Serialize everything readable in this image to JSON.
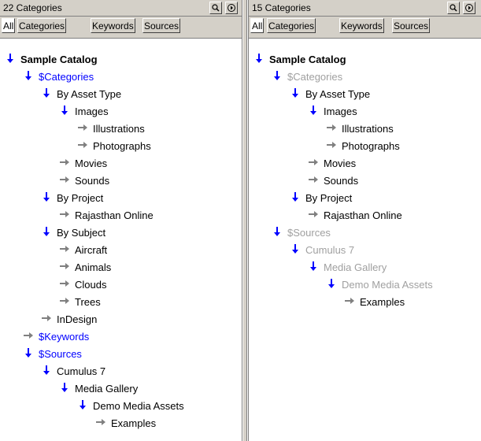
{
  "colors": {
    "link": "#0000ff",
    "dimmed": "#a0a0a0",
    "arrow_expanded": "#0000ff",
    "arrow_collapsed": "#808080"
  },
  "left": {
    "title": "22 Categories",
    "tabs": [
      "All",
      "Categories",
      "Keywords",
      "Sources"
    ],
    "tree": [
      {
        "label": "Sample Catalog",
        "level": 0,
        "arrow": "down",
        "style": "bold"
      },
      {
        "label": "$Categories",
        "level": 1,
        "arrow": "down",
        "style": "blue"
      },
      {
        "label": "By Asset Type",
        "level": 2,
        "arrow": "down",
        "style": "normal"
      },
      {
        "label": "Images",
        "level": 3,
        "arrow": "down",
        "style": "normal"
      },
      {
        "label": "Illustrations",
        "level": 4,
        "arrow": "right",
        "style": "normal"
      },
      {
        "label": "Photographs",
        "level": 4,
        "arrow": "right",
        "style": "normal"
      },
      {
        "label": "Movies",
        "level": 3,
        "arrow": "right",
        "style": "normal"
      },
      {
        "label": "Sounds",
        "level": 3,
        "arrow": "right",
        "style": "normal"
      },
      {
        "label": "By Project",
        "level": 2,
        "arrow": "down",
        "style": "normal"
      },
      {
        "label": "Rajasthan Online",
        "level": 3,
        "arrow": "right",
        "style": "normal"
      },
      {
        "label": "By Subject",
        "level": 2,
        "arrow": "down",
        "style": "normal"
      },
      {
        "label": "Aircraft",
        "level": 3,
        "arrow": "right",
        "style": "normal"
      },
      {
        "label": "Animals",
        "level": 3,
        "arrow": "right",
        "style": "normal"
      },
      {
        "label": "Clouds",
        "level": 3,
        "arrow": "right",
        "style": "normal"
      },
      {
        "label": "Trees",
        "level": 3,
        "arrow": "right",
        "style": "normal"
      },
      {
        "label": "InDesign",
        "level": 2,
        "arrow": "right",
        "style": "normal"
      },
      {
        "label": "$Keywords",
        "level": 1,
        "arrow": "right",
        "style": "blue"
      },
      {
        "label": "$Sources",
        "level": 1,
        "arrow": "down",
        "style": "blue"
      },
      {
        "label": "Cumulus 7",
        "level": 2,
        "arrow": "down",
        "style": "normal"
      },
      {
        "label": "Media Gallery",
        "level": 3,
        "arrow": "down",
        "style": "normal"
      },
      {
        "label": "Demo Media Assets",
        "level": 4,
        "arrow": "down",
        "style": "normal"
      },
      {
        "label": "Examples",
        "level": 5,
        "arrow": "right",
        "style": "normal"
      }
    ]
  },
  "right": {
    "title": "15 Categories",
    "tabs": [
      "All",
      "Categories",
      "Keywords",
      "Sources"
    ],
    "tree": [
      {
        "label": "Sample Catalog",
        "level": 0,
        "arrow": "down",
        "style": "bold"
      },
      {
        "label": "$Categories",
        "level": 1,
        "arrow": "down",
        "style": "grey"
      },
      {
        "label": "By Asset Type",
        "level": 2,
        "arrow": "down",
        "style": "normal"
      },
      {
        "label": "Images",
        "level": 3,
        "arrow": "down",
        "style": "normal"
      },
      {
        "label": "Illustrations",
        "level": 4,
        "arrow": "right",
        "style": "normal"
      },
      {
        "label": "Photographs",
        "level": 4,
        "arrow": "right",
        "style": "normal"
      },
      {
        "label": "Movies",
        "level": 3,
        "arrow": "right",
        "style": "normal"
      },
      {
        "label": "Sounds",
        "level": 3,
        "arrow": "right",
        "style": "normal"
      },
      {
        "label": "By Project",
        "level": 2,
        "arrow": "down",
        "style": "normal"
      },
      {
        "label": "Rajasthan Online",
        "level": 3,
        "arrow": "right",
        "style": "normal"
      },
      {
        "label": "$Sources",
        "level": 1,
        "arrow": "down",
        "style": "grey"
      },
      {
        "label": "Cumulus 7",
        "level": 2,
        "arrow": "down",
        "style": "grey"
      },
      {
        "label": "Media Gallery",
        "level": 3,
        "arrow": "down",
        "style": "grey"
      },
      {
        "label": "Demo Media Assets",
        "level": 4,
        "arrow": "down",
        "style": "grey"
      },
      {
        "label": "Examples",
        "level": 5,
        "arrow": "right",
        "style": "normal"
      }
    ]
  }
}
